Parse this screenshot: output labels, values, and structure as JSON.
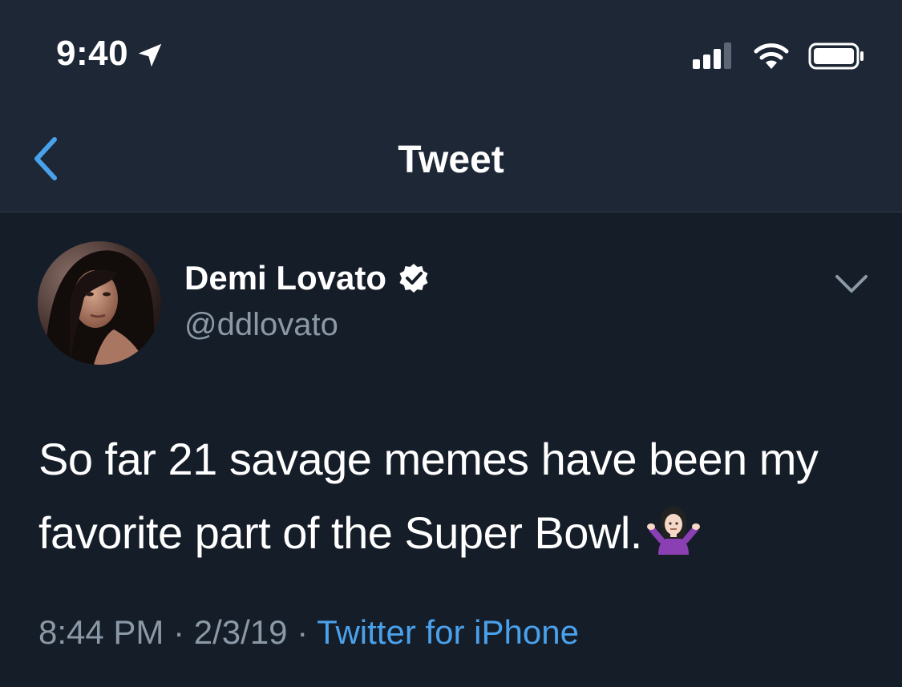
{
  "status_bar": {
    "time": "9:40"
  },
  "nav": {
    "title": "Tweet"
  },
  "tweet": {
    "author_name": "Demi Lovato",
    "author_handle": "@ddlovato",
    "text": "So far 21 savage memes have been my favorite part of the Super Bowl.",
    "time": "8:44 PM",
    "date": "2/3/19",
    "separator": "·",
    "source": "Twitter for iPhone"
  },
  "icons": {
    "back": "chevron-left-icon",
    "location": "location-arrow-icon",
    "verified": "verified-badge-icon",
    "menu": "chevron-down-icon",
    "emoji": "person-shrugging-emoji"
  },
  "colors": {
    "background": "#151d29",
    "header": "#1d2736",
    "accent": "#4aa1eb",
    "secondary_text": "#8b98a5"
  }
}
